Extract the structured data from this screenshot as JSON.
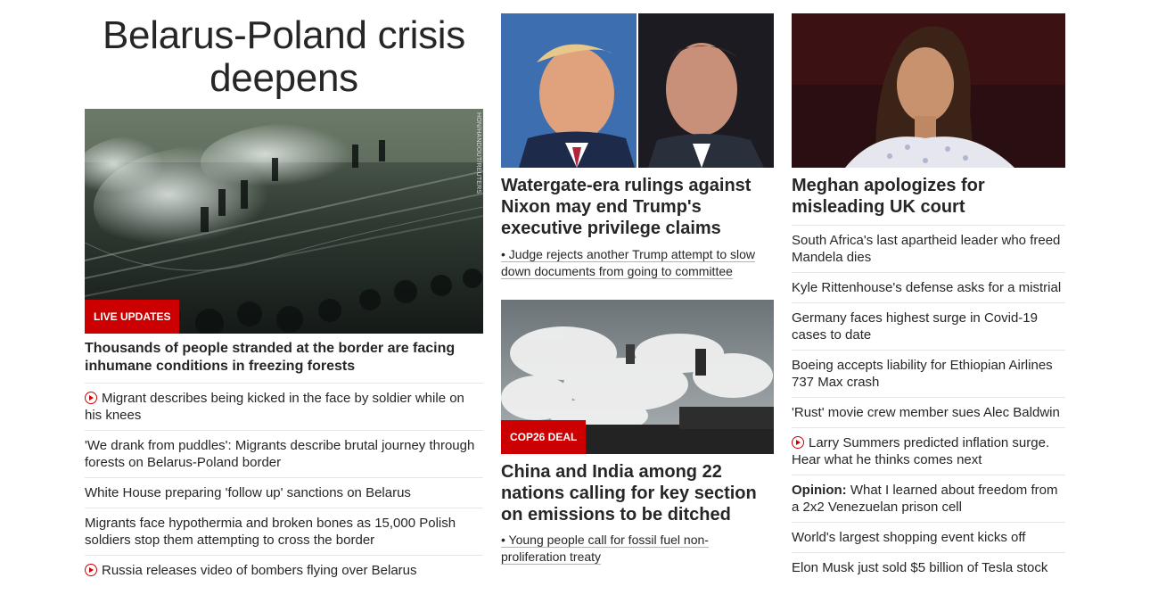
{
  "col1": {
    "title": "Belarus-Poland crisis deepens",
    "image_credit": "HON/HANDOUT/REUTERS",
    "badge": "LIVE UPDATES",
    "headline": "Thousands of people stranded at the border are facing inhumane conditions in freezing forests",
    "items": [
      {
        "text": "Migrant describes being kicked in the face by soldier while on his knees",
        "video": true
      },
      {
        "text": "'We drank from puddles': Migrants describe brutal journey through forests on Belarus-Poland border",
        "video": false
      },
      {
        "text": "White House preparing 'follow up' sanctions on Belarus",
        "video": false
      },
      {
        "text": "Migrants face hypothermia and broken bones as 15,000 Polish soldiers stop them attempting to cross the border",
        "video": false
      },
      {
        "text": "Russia releases video of bombers flying over Belarus",
        "video": true
      }
    ]
  },
  "col2": {
    "story1": {
      "headline": "Watergate-era rulings against Nixon may end Trump's executive privilege claims",
      "bullet": "• Judge rejects another Trump attempt to slow down documents from going to committee"
    },
    "story2": {
      "badge": "COP26 DEAL",
      "headline": "China and India among 22 nations calling for key section on emissions to be ditched",
      "bullet": "• Young people call for fossil fuel non-proliferation treaty"
    }
  },
  "col3": {
    "headline": "Meghan apologizes for misleading UK court",
    "items": [
      {
        "text": "South Africa's last apartheid leader who freed Mandela dies"
      },
      {
        "text": "Kyle Rittenhouse's defense asks for a mistrial"
      },
      {
        "text": "Germany faces highest surge in Covid-19 cases to date"
      },
      {
        "text": "Boeing accepts liability for Ethiopian Airlines 737 Max crash"
      },
      {
        "text": "'Rust' movie crew member sues Alec Baldwin"
      },
      {
        "text": "Larry Summers predicted inflation surge. Hear what he thinks comes next",
        "video": true
      },
      {
        "prefix": "Opinion:",
        "text": " What I learned about freedom from a 2x2 Venezuelan prison cell"
      },
      {
        "text": "World's largest shopping event kicks off"
      },
      {
        "text": "Elon Musk just sold $5 billion of Tesla stock"
      }
    ]
  },
  "colors": {
    "accent": "#cc0000",
    "text": "#262626",
    "divider": "#e6e6e6"
  }
}
